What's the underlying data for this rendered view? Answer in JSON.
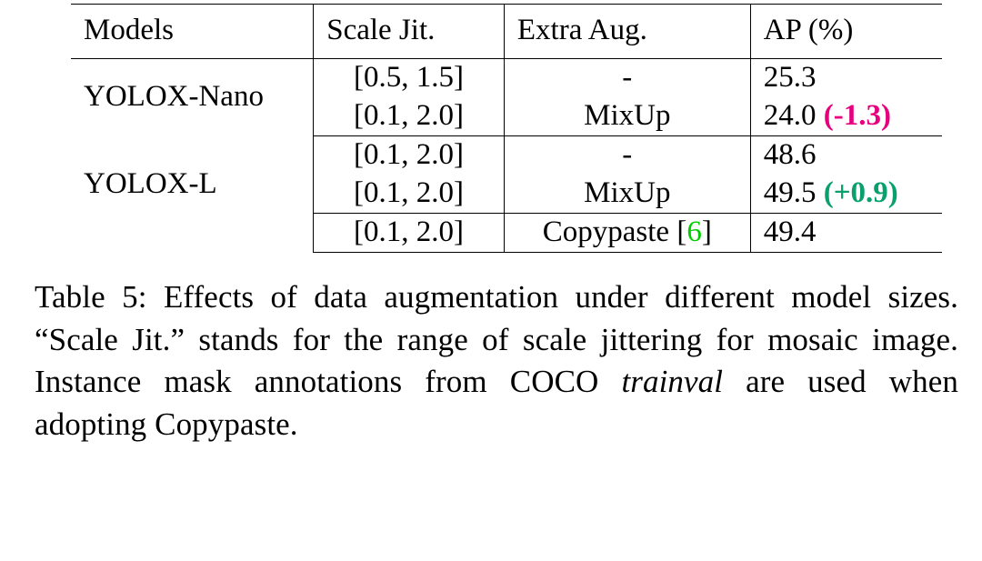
{
  "chart_data": {
    "type": "table",
    "columns": [
      "Models",
      "Scale Jit.",
      "Extra Aug.",
      "AP (%)"
    ],
    "groups": [
      {
        "model": "YOLOX-Nano",
        "rows": [
          {
            "scale_jit": "[0.5, 1.5]",
            "extra_aug": "-",
            "ap": 25.3,
            "delta": null
          },
          {
            "scale_jit": "[0.1, 2.0]",
            "extra_aug": "MixUp",
            "ap": 24.0,
            "delta": "(-1.3)"
          }
        ]
      },
      {
        "model": "YOLOX-L",
        "rows": [
          {
            "scale_jit": "[0.1, 2.0]",
            "extra_aug": "-",
            "ap": 48.6,
            "delta": null
          },
          {
            "scale_jit": "[0.1, 2.0]",
            "extra_aug": "MixUp",
            "ap": 49.5,
            "delta": "(+0.9)"
          },
          {
            "scale_jit": "[0.1, 2.0]",
            "extra_aug": "Copypaste [6]",
            "ap": 49.4,
            "delta": null
          }
        ]
      }
    ]
  },
  "headers": {
    "models": "Models",
    "scale": "Scale Jit.",
    "extra": "Extra Aug.",
    "ap": "AP (%)"
  },
  "rows": {
    "g0": {
      "model": "YOLOX-Nano",
      "r0": {
        "scale": "[0.5, 1.5]",
        "extra": "-",
        "ap": "25.3",
        "delta": ""
      },
      "r1": {
        "scale": "[0.1, 2.0]",
        "extra": "MixUp",
        "ap": "24.0",
        "delta": "(-1.3)"
      }
    },
    "g1": {
      "model": "YOLOX-L",
      "r0": {
        "scale": "[0.1, 2.0]",
        "extra": "-",
        "ap": "48.6",
        "delta": ""
      },
      "r1": {
        "scale": "[0.1, 2.0]",
        "extra": "MixUp",
        "ap": "49.5",
        "delta": "(+0.9)"
      },
      "r2": {
        "scale": "[0.1, 2.0]",
        "extra_pre": "Copypaste [",
        "extra_cite": "6",
        "extra_post": "]",
        "ap": "49.4",
        "delta": ""
      }
    }
  },
  "caption": {
    "prefix": "Table 5: Effects of data augmentation under different model sizes.  “Scale Jit.”  stands for the range of scale jittering for mosaic image. Instance mask annotations from COCO ",
    "ital": "trainval",
    "suffix": " are used when adopting Copypaste."
  }
}
